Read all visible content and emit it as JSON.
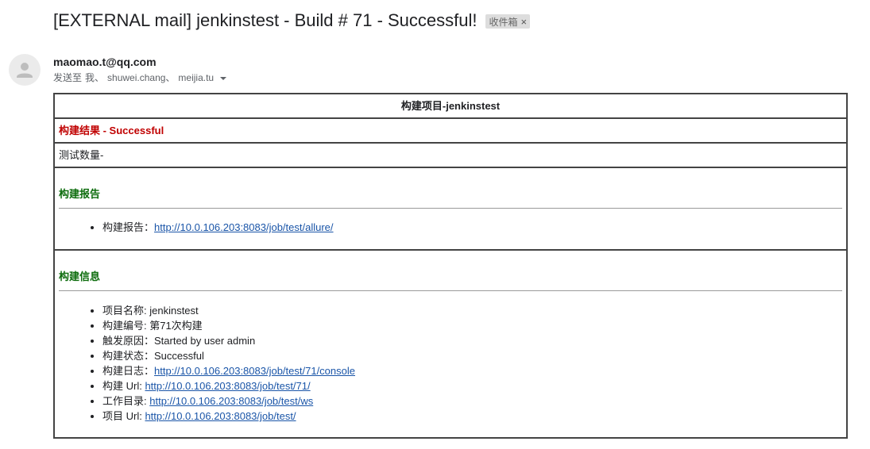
{
  "header": {
    "subject": "[EXTERNAL mail] jenkinstest - Build # 71 - Successful!",
    "label_chip": "收件箱",
    "label_chip_close": "×"
  },
  "sender": {
    "email": "maomao.t@qq.com",
    "recipients_prefix": "发送至",
    "recipients": [
      "我、",
      "shuwei.chang、",
      "meijia.tu"
    ]
  },
  "build": {
    "title": "构建项目-jenkinstest",
    "result": "构建结果 - Successful",
    "tests": "测试数量-",
    "report": {
      "heading": "构建报告",
      "items": [
        {
          "label": "构建报告：",
          "link": "http://10.0.106.203:8083/job/test/allure/"
        }
      ]
    },
    "info": {
      "heading": "构建信息",
      "items": [
        {
          "label": "项目名称: jenkinstest",
          "link": ""
        },
        {
          "label": "构建编号: 第71次构建",
          "link": ""
        },
        {
          "label": "触发原因：Started by user admin",
          "link": ""
        },
        {
          "label": "构建状态：Successful",
          "link": ""
        },
        {
          "label": "构建日志：",
          "link": "http://10.0.106.203:8083/job/test/71/console"
        },
        {
          "label": "构建 Url: ",
          "link": "http://10.0.106.203:8083/job/test/71/"
        },
        {
          "label": "工作目录: ",
          "link": "http://10.0.106.203:8083/job/test/ws"
        },
        {
          "label": "项目 Url: ",
          "link": "http://10.0.106.203:8083/job/test/"
        }
      ]
    }
  },
  "colors": {
    "result_red": "#c00000",
    "heading_green": "#0b6b0b",
    "link_blue": "#1a55a8",
    "table_border": "#444444"
  },
  "icons": {
    "avatar": "default-person-icon",
    "recipients_toggle": "caret-down-icon"
  }
}
